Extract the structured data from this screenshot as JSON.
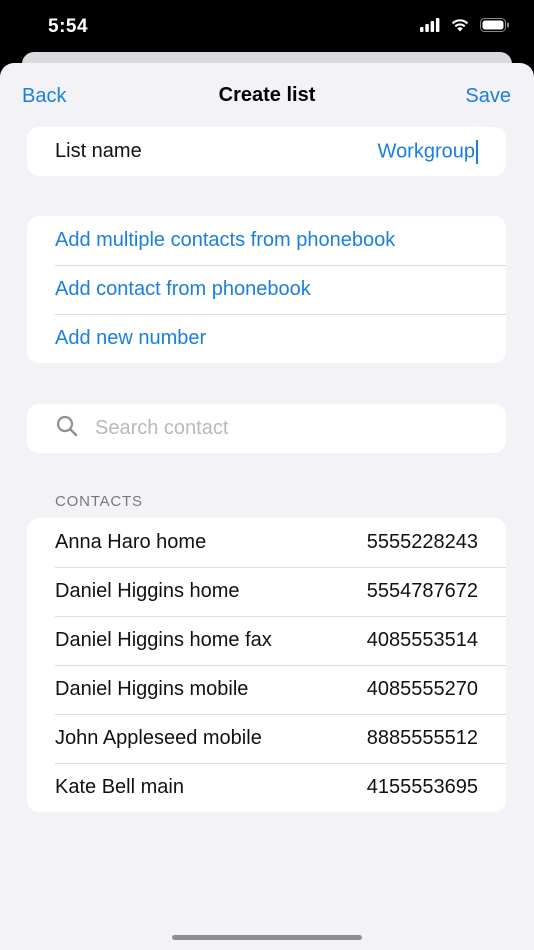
{
  "status_bar": {
    "time": "5:54"
  },
  "nav": {
    "back_label": "Back",
    "title": "Create list",
    "save_label": "Save"
  },
  "list_name": {
    "label": "List name",
    "value": "Workgroup"
  },
  "actions": [
    {
      "label": "Add multiple contacts from phonebook"
    },
    {
      "label": "Add contact from phonebook"
    },
    {
      "label": "Add new number"
    }
  ],
  "search": {
    "placeholder": "Search contact",
    "value": ""
  },
  "contacts_section": {
    "header": "CONTACTS",
    "items": [
      {
        "name": "Anna Haro home",
        "number": "5555228243"
      },
      {
        "name": "Daniel Higgins home",
        "number": "5554787672"
      },
      {
        "name": "Daniel Higgins home fax",
        "number": "4085553514"
      },
      {
        "name": "Daniel Higgins mobile",
        "number": "4085555270"
      },
      {
        "name": "John Appleseed mobile",
        "number": "8885555512"
      },
      {
        "name": "Kate Bell main",
        "number": "4155553695"
      }
    ]
  },
  "colors": {
    "accent": "#1a7fe0",
    "background": "#f2f2f7",
    "card": "#ffffff"
  },
  "icons": {
    "search": "magnifying-glass",
    "signal": "cellular-signal",
    "wifi": "wifi",
    "battery": "battery"
  }
}
